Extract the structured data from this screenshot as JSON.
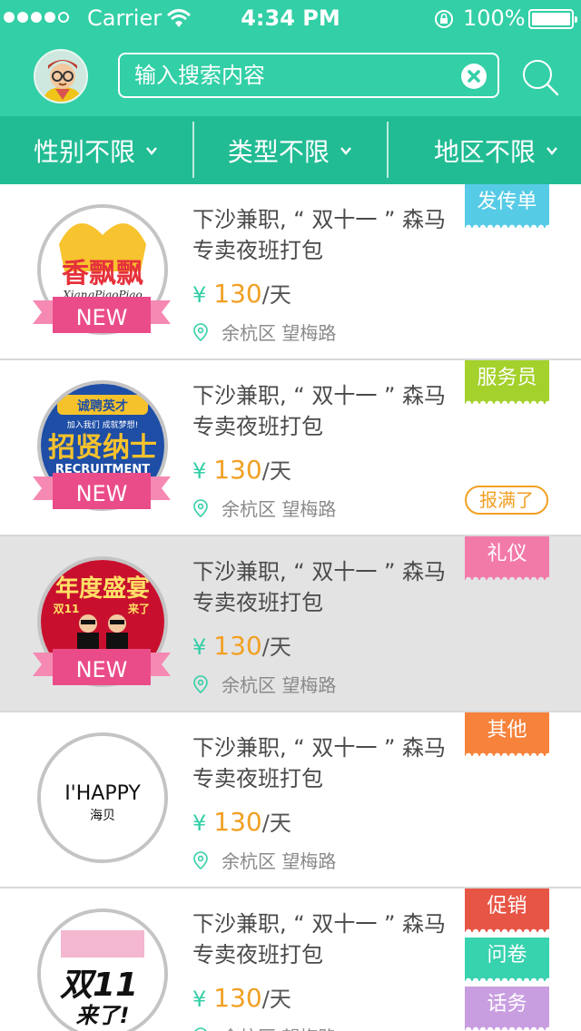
{
  "status_bar": {
    "carrier": "Carrier",
    "time": "4:34 PM",
    "battery": "100%"
  },
  "search": {
    "placeholder": "输入搜索内容"
  },
  "filters": [
    {
      "label": "性别不限"
    },
    {
      "label": "类型不限"
    },
    {
      "label": "地区不限"
    }
  ],
  "new_label": "NEW",
  "jobs": [
    {
      "title": "下沙兼职, “ 双十一 ” 森马专卖夜班打包",
      "currency": "¥",
      "price": "130",
      "unit": "/天",
      "location": "余杭区 望梅路",
      "category": "发传单",
      "category_color": "#56cbe6",
      "brand": "香飘飘",
      "brand_sub": "XiangPiaoPiao"
    },
    {
      "title": "下沙兼职, “ 双十一 ” 森马专卖夜班打包",
      "currency": "¥",
      "price": "130",
      "unit": "/天",
      "location": "余杭区 望梅路",
      "category": "服务员",
      "category_color": "#a4d12b",
      "status": "报满了",
      "brand_top": "诚聘英才",
      "brand_mid": "加入我们 成就梦想!",
      "brand": "招贤纳士",
      "brand_sub": "RECRUITMENT"
    },
    {
      "title": "下沙兼职, “ 双十一 ” 森马专卖夜班打包",
      "currency": "¥",
      "price": "130",
      "unit": "/天",
      "location": "余杭区 望梅路",
      "category": "礼仪",
      "category_color": "#f27aa9",
      "brand": "年度盛宴",
      "brand_left": "双11",
      "brand_right": "来了"
    },
    {
      "title": "下沙兼职, “ 双十一 ” 森马专卖夜班打包",
      "currency": "¥",
      "price": "130",
      "unit": "/天",
      "location": "余杭区 望梅路",
      "category": "其他",
      "category_color": "#f6823b",
      "brand": "I'HAPPY",
      "brand_sub": "海贝"
    },
    {
      "title": "下沙兼职, “ 双十一 ” 森马专卖夜班打包",
      "currency": "¥",
      "price": "130",
      "unit": "/天",
      "location": "余杭区 望梅路",
      "categories": [
        "促销",
        "问卷",
        "话务"
      ],
      "brand": "双11",
      "brand_sub": "来了!"
    }
  ]
}
